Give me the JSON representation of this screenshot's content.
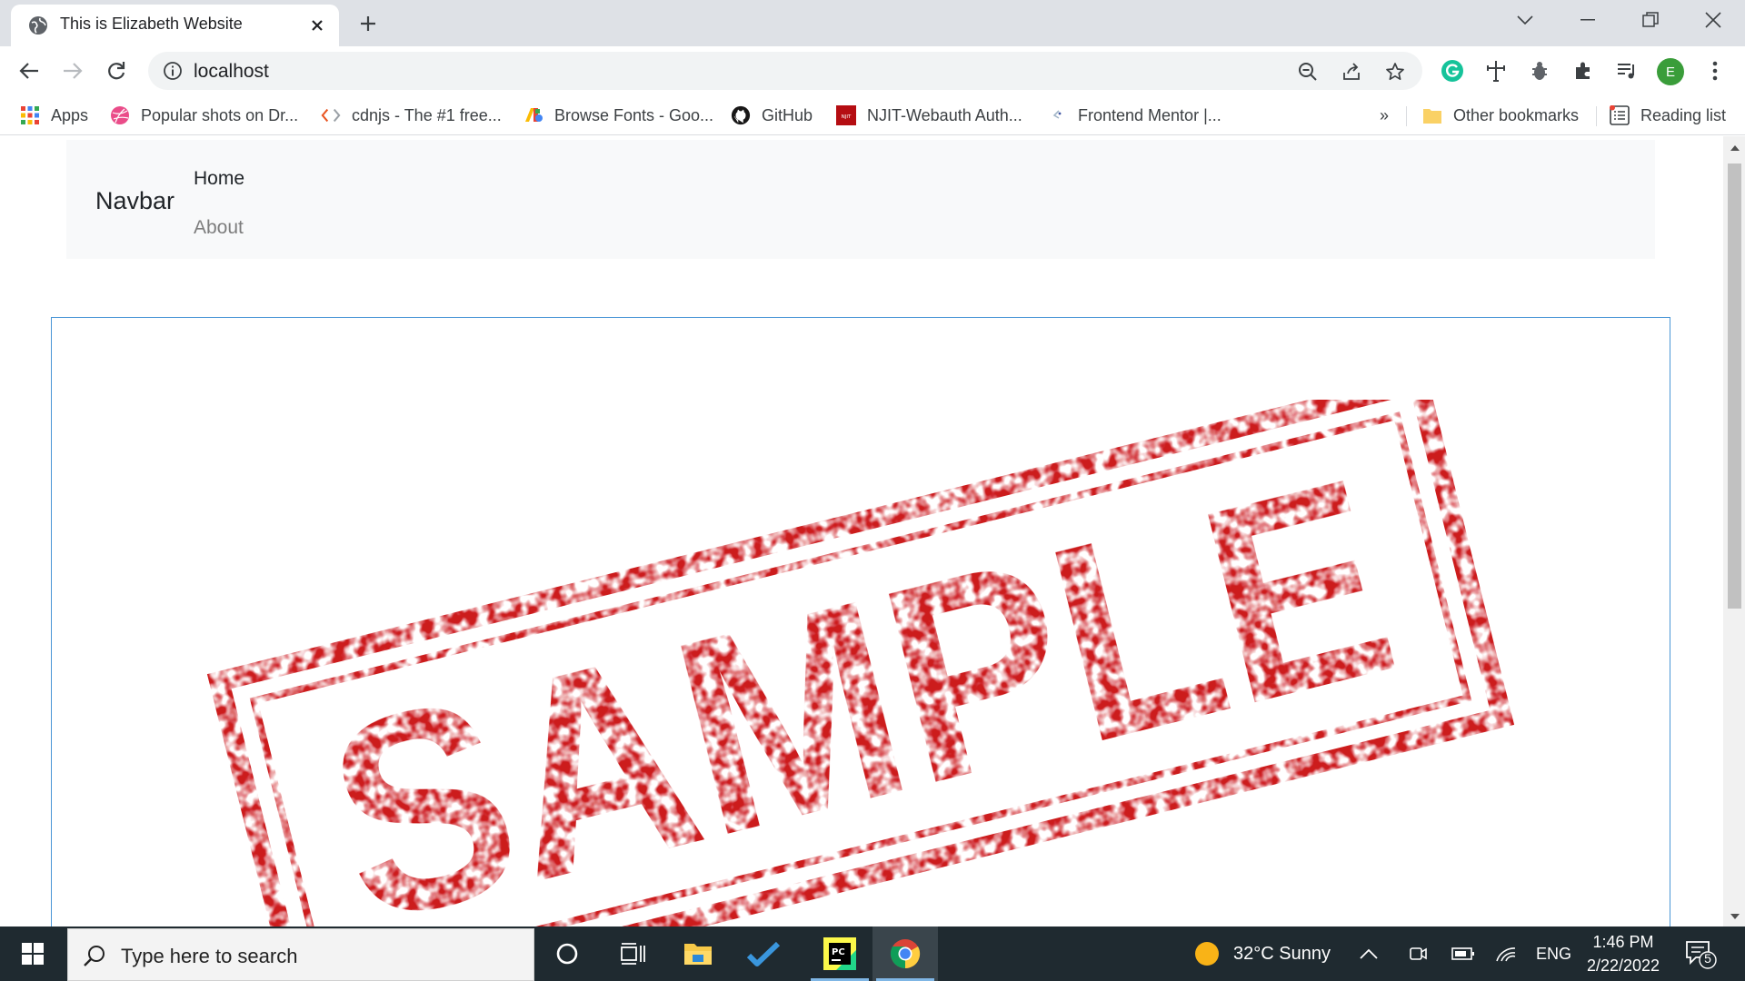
{
  "browser": {
    "tab_title": "This is Elizabeth Website",
    "address": "localhost",
    "profile_initial": "E",
    "accent": "#1a73e8"
  },
  "bookmarks": {
    "items": [
      {
        "label": "Apps",
        "icon": "apps-grid-icon"
      },
      {
        "label": "Popular shots on Dr...",
        "icon": "dribbble-icon"
      },
      {
        "label": "cdnjs - The #1 free...",
        "icon": "cdnjs-icon"
      },
      {
        "label": "Browse Fonts - Goo...",
        "icon": "google-fonts-icon"
      },
      {
        "label": "GitHub",
        "icon": "github-icon"
      },
      {
        "label": "NJIT-Webauth Auth...",
        "icon": "njit-icon"
      },
      {
        "label": "Frontend Mentor |...",
        "icon": "frontend-mentor-icon"
      }
    ],
    "overflow": "»",
    "other": "Other bookmarks",
    "reading_list": "Reading list"
  },
  "page": {
    "brand": "Navbar",
    "nav": [
      {
        "label": "Home"
      },
      {
        "label": "About"
      }
    ],
    "image_text": "SAMPLE",
    "stamp_color": "#cc1a1f"
  },
  "taskbar": {
    "search_placeholder": "Type here to search",
    "weather": "32°C  Sunny",
    "language": "ENG",
    "time": "1:46 PM",
    "date": "2/22/2022",
    "notifications": "5"
  }
}
